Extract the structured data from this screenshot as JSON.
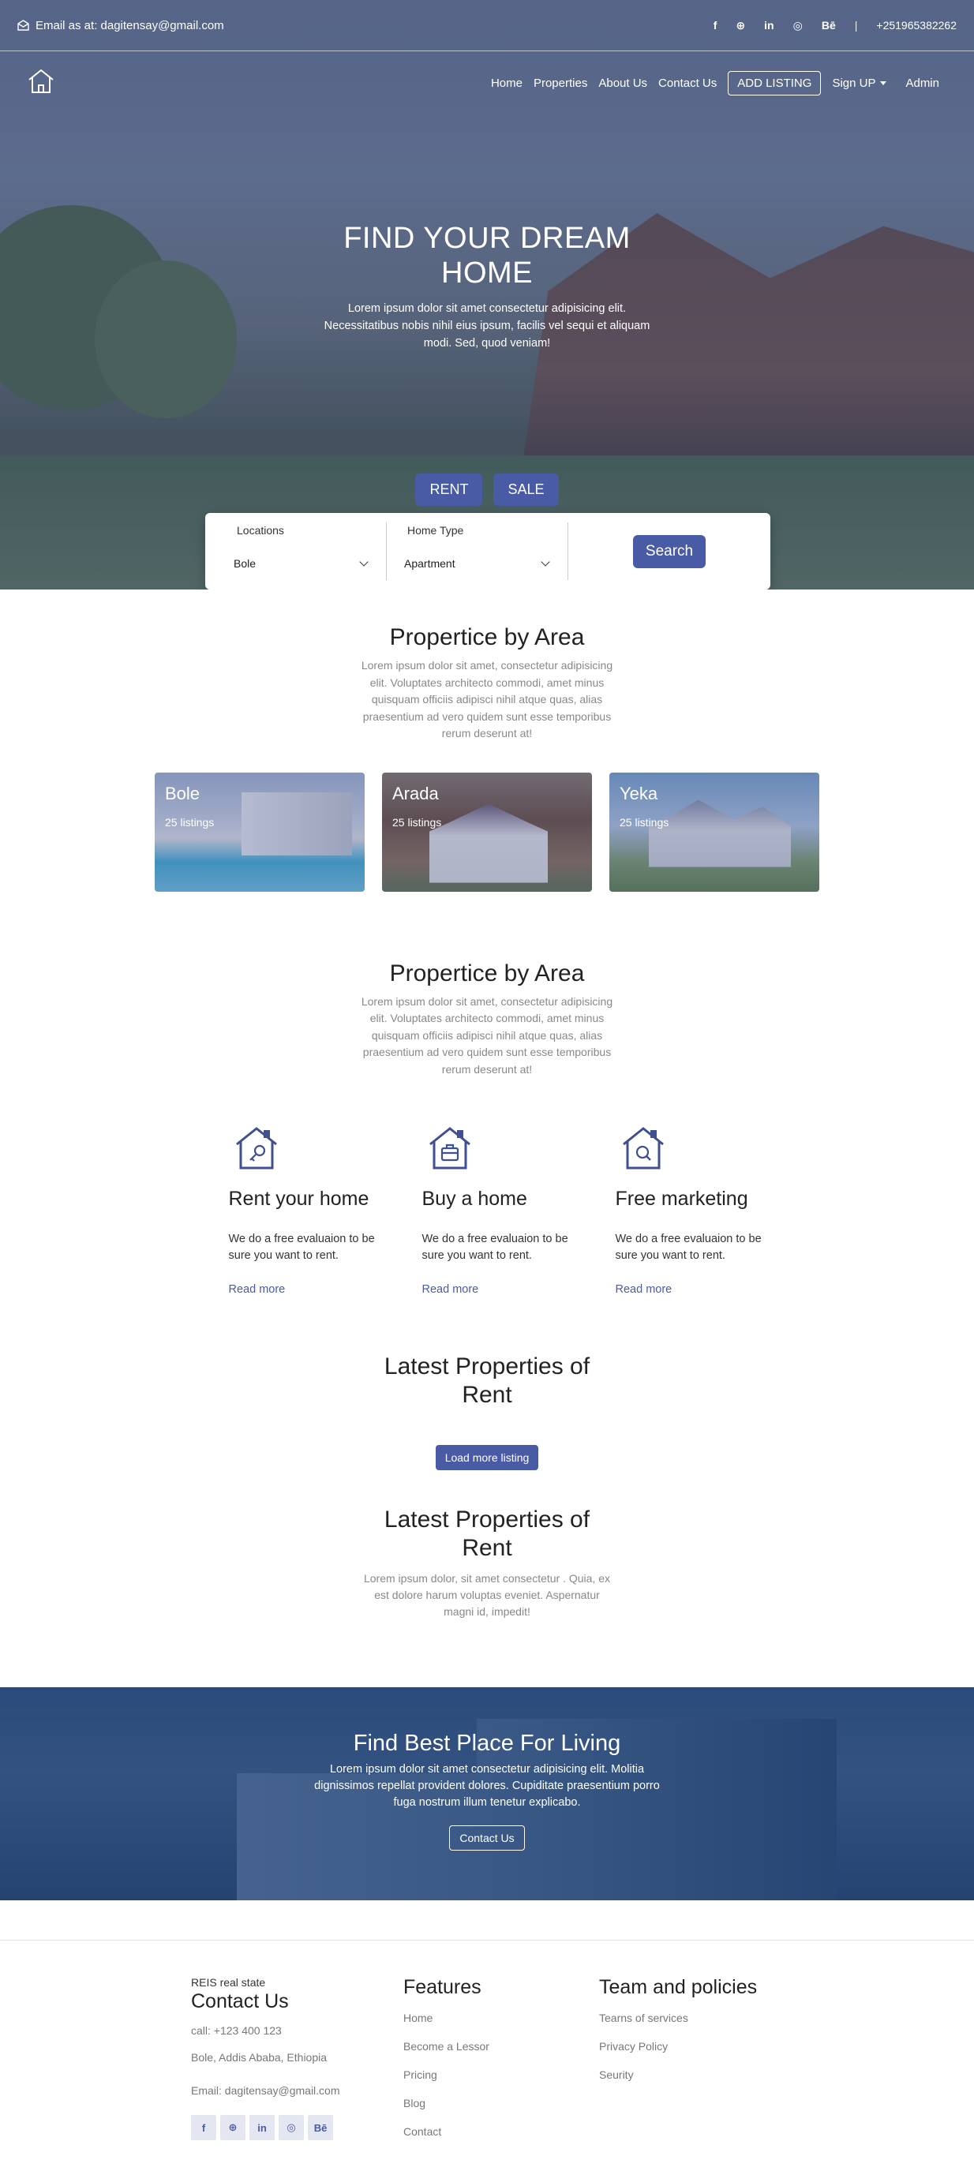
{
  "topbar": {
    "email": "Email as at: dagitensay@gmail.com",
    "socials": [
      "f",
      "⊕",
      "in",
      "◎",
      "Bē"
    ],
    "separator": "|",
    "phone": "+251965382262"
  },
  "nav": {
    "links": [
      "Home",
      "Properties",
      "About Us",
      "Contact Us"
    ],
    "add_listing": "ADD LISTING",
    "signup": "Sign UP",
    "admin": "Admin"
  },
  "hero": {
    "title": "FIND YOUR DREAM HOME",
    "subtitle": "Lorem ipsum dolor sit amet consectetur adipisicing elit. Necessitatibus nobis nihil eius ipsum, facilis vel sequi et aliquam modi. Sed, quod veniam!",
    "rent": "RENT",
    "sale": "SALE"
  },
  "search": {
    "locations_label": "Locations",
    "locations_value": "Bole",
    "hometype_label": "Home Type",
    "hometype_value": "Apartment",
    "button": "Search"
  },
  "areas": {
    "title": "Propertice by Area",
    "text": "Lorem ipsum dolor sit amet, consectetur adipisicing elit. Voluptates architecto commodi, amet minus quisquam officiis adipisci nihil atque quas, alias praesentium ad vero quidem sunt esse temporibus rerum deserunt at!",
    "cards": [
      {
        "name": "Bole",
        "listings": "25 listings"
      },
      {
        "name": "Arada",
        "listings": "25 listings"
      },
      {
        "name": "Yeka",
        "listings": "25 listings"
      }
    ]
  },
  "services": {
    "title": "Propertice by Area",
    "text": "Lorem ipsum dolor sit amet, consectetur adipisicing elit. Voluptates architecto commodi, amet minus quisquam officiis adipisci nihil atque quas, alias praesentium ad vero quidem sunt esse temporibus rerum deserunt at!",
    "items": [
      {
        "title": "Rent your home",
        "text": "We do a free evaluaion to be sure you want to rent.",
        "link": "Read more",
        "icon": "house-key-icon"
      },
      {
        "title": "Buy a home",
        "text": "We do a free evaluaion to be sure you want to rent.",
        "link": "Read more",
        "icon": "house-briefcase-icon"
      },
      {
        "title": "Free marketing",
        "text": "We do a free evaluaion to be sure you want to rent.",
        "link": "Read more",
        "icon": "house-search-icon"
      }
    ]
  },
  "latest": {
    "title": "Latest Properties of Rent",
    "load_more": "Load more listing",
    "title2": "Latest Properties of Rent",
    "text2": "Lorem ipsum dolor, sit amet consectetur . Quia, ex est dolore harum voluptas eveniet. Aspernatur magni id, impedit!"
  },
  "cta": {
    "title": "Find Best Place For Living",
    "text": "Lorem ipsum dolor sit amet consectetur adipisicing elit. Molitia dignissimos repellat provident dolores. Cupiditate praesentium porro fuga nostrum illum tenetur explicabo.",
    "button": "Contact Us"
  },
  "footer": {
    "brand": "REIS real state",
    "contact_title": "Contact Us",
    "call": "call: +123 400 123",
    "address": "Bole, Addis Ababa, Ethiopia",
    "email": "Email: dagitensay@gmail.com",
    "socials": [
      "f",
      "⊕",
      "in",
      "◎",
      "Bē"
    ],
    "features_title": "Features",
    "features": [
      "Home",
      "Become a Lessor",
      "Pricing",
      "Blog",
      "Contact"
    ],
    "team_title": "Team and policies",
    "team": [
      "Tearns of services",
      "Privacy Policy",
      "Seurity"
    ]
  },
  "colors": {
    "accent": "#4a5ba5",
    "muted": "#888888"
  }
}
